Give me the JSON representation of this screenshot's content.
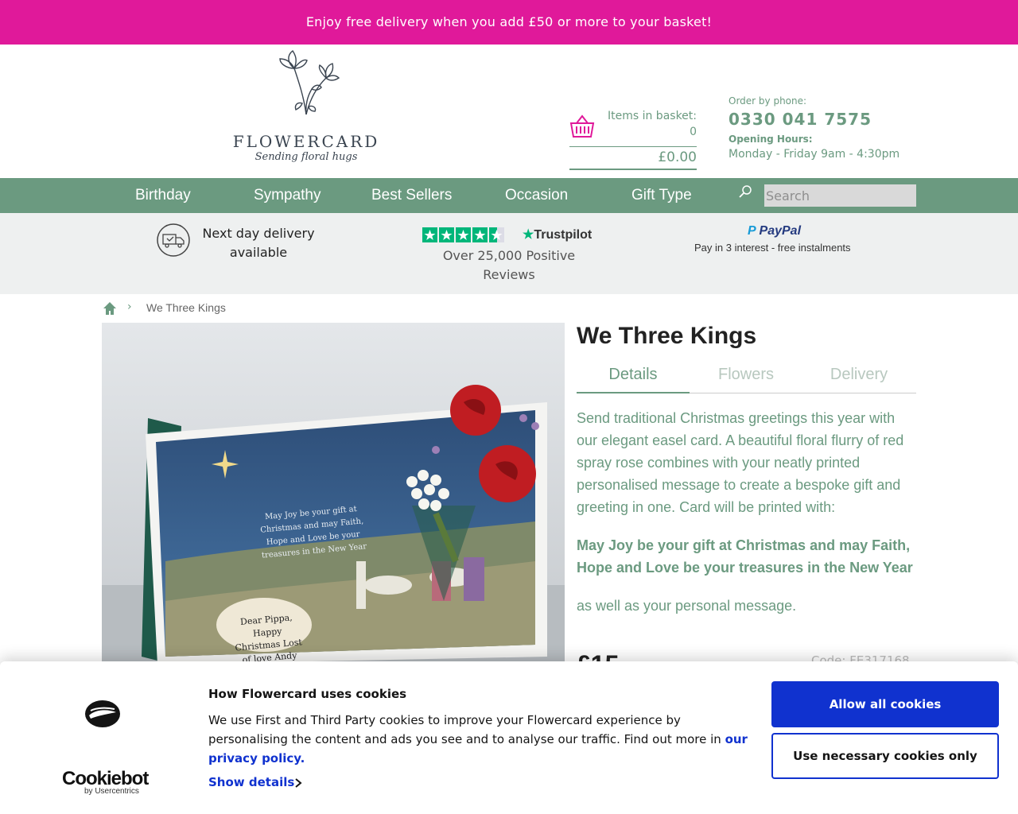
{
  "promo": {
    "text": "Enjoy free delivery when you add £50 or more to your basket!"
  },
  "brand": {
    "name": "FLOWERCARD",
    "tagline": "Sending floral hugs"
  },
  "basket": {
    "label": "Items in basket:",
    "count": "0",
    "total": "£0.00"
  },
  "contact": {
    "order_label": "Order by phone:",
    "phone": "0330 041 7575",
    "hours_label": "Opening Hours:",
    "hours": "Monday - Friday 9am - 4:30pm"
  },
  "nav": {
    "items": [
      {
        "label": "Birthday"
      },
      {
        "label": "Sympathy"
      },
      {
        "label": "Best Sellers"
      },
      {
        "label": "Occasion"
      },
      {
        "label": "Gift Type"
      }
    ],
    "search_placeholder": "Search"
  },
  "trust": {
    "delivery": "Next day delivery available",
    "trustpilot_brand": "Trustpilot",
    "reviews": "Over 25,000 Positive Reviews",
    "paypal_brand": "PayPal",
    "paypal_tagline": "Pay in 3 interest - free instalments"
  },
  "breadcrumb": {
    "current": "We Three Kings"
  },
  "product": {
    "title": "We Three Kings",
    "tabs": [
      {
        "label": "Details"
      },
      {
        "label": "Flowers"
      },
      {
        "label": "Delivery"
      }
    ],
    "description": "Send traditional Christmas greetings this year with our elegant easel card. A beautiful floral flurry of red spray rose combines with your neatly printed personalised message to create a bespoke gift and greeting in one. Card will be printed with:",
    "verse": "May Joy be your gift at Christmas and may Faith, Hope and Love be your treasures in the New Year",
    "tail": "as well as your personal message.",
    "price": "£15",
    "code": "Code: FE317168",
    "card_message": "May Joy be your gift at Christmas and may Faith, Hope and Love be your treasures in the New Year",
    "card_personal": "Dear Pippa, Happy Christmas Lost of love Andy"
  },
  "cookie": {
    "logo_word": "Cookiebot",
    "logo_by": "by Usercentrics",
    "title": "How Flowercard uses cookies",
    "body": "We use First and Third Party cookies to improve your Flowercard experience by personalising the content and ads you see and to analyse our traffic. Find out more in ",
    "link": "our privacy policy.",
    "show_details": "Show details",
    "allow_all": "Allow all cookies",
    "necessary_only": "Use necessary cookies only"
  },
  "colors": {
    "promo_pink": "#e0199a",
    "brand_green": "#6b9a80",
    "cookie_blue": "#1032cf"
  }
}
